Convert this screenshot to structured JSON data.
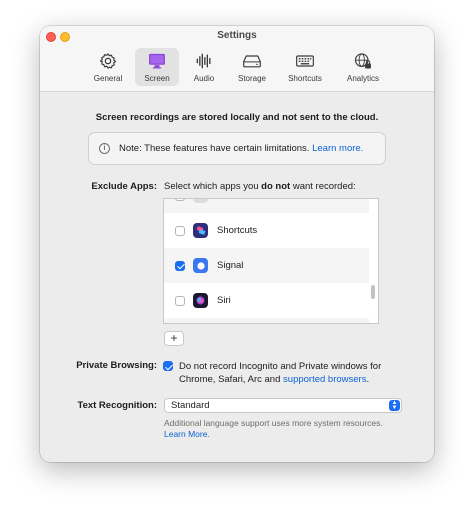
{
  "window": {
    "title": "Settings"
  },
  "tabs": [
    {
      "label": "General",
      "icon": "gear-icon"
    },
    {
      "label": "Screen",
      "icon": "monitor-icon",
      "active": true
    },
    {
      "label": "Audio",
      "icon": "waveform-icon"
    },
    {
      "label": "Storage",
      "icon": "drive-icon"
    },
    {
      "label": "Shortcuts",
      "icon": "keyboard-icon"
    },
    {
      "label": "Analytics",
      "icon": "globe-lock-icon"
    }
  ],
  "main": {
    "privacy_notice": "Screen recordings are stored locally and not sent to the cloud.",
    "info": {
      "text": "Note: These features have certain limitations.",
      "link": "Learn more."
    },
    "exclude_apps": {
      "label": "Exclude Apps:",
      "desc_before": "Select which apps you ",
      "desc_bold": "do not",
      "desc_after": " want recorded:",
      "apps": [
        {
          "name": "Shortcuts",
          "checked": false,
          "icon": "shortcuts-app-icon"
        },
        {
          "name": "Signal",
          "checked": true,
          "icon": "signal-app-icon"
        },
        {
          "name": "Siri",
          "checked": false,
          "icon": "siri-app-icon"
        }
      ],
      "add_label": "+"
    },
    "private_browsing": {
      "label": "Private Browsing:",
      "checked": true,
      "text": "Do not record Incognito and Private windows for Chrome, Safari, Arc and",
      "link": "supported browsers",
      "suffix": "."
    },
    "text_recognition": {
      "label": "Text Recognition:",
      "value": "Standard",
      "help": "Additional language support uses more system resources.",
      "help_link": "Learn More."
    }
  },
  "colors": {
    "accent": "#1b6ef3",
    "link": "#0a64d6",
    "active_tab_icon": "#8a43d9"
  }
}
